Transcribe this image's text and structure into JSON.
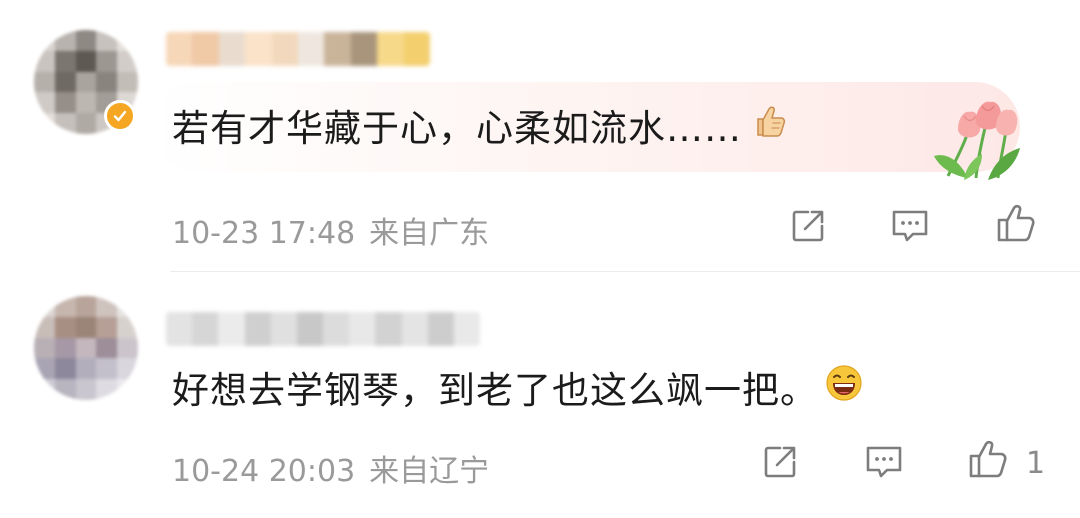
{
  "comments": [
    {
      "content": "若有才华藏于心，心柔如流水……",
      "emoji": "thumbs-up",
      "time": "10-23 17:48",
      "location": "来自广东",
      "like_count": ""
    },
    {
      "content": "好想去学钢琴，到老了也这么飒一把。",
      "emoji": "laughing-face",
      "time": "10-24 20:03",
      "location": "来自辽宁",
      "like_count": "1"
    }
  ],
  "icons": {
    "share": "share-icon",
    "reply": "comment-icon",
    "like": "thumbs-up-icon",
    "verified": "verified-badge-icon"
  },
  "colors": {
    "meta_text": "#9a9a9a",
    "icon_stroke": "#7d7d7d",
    "badge": "#f5a623",
    "bubble_tint": "#fde8e6"
  }
}
